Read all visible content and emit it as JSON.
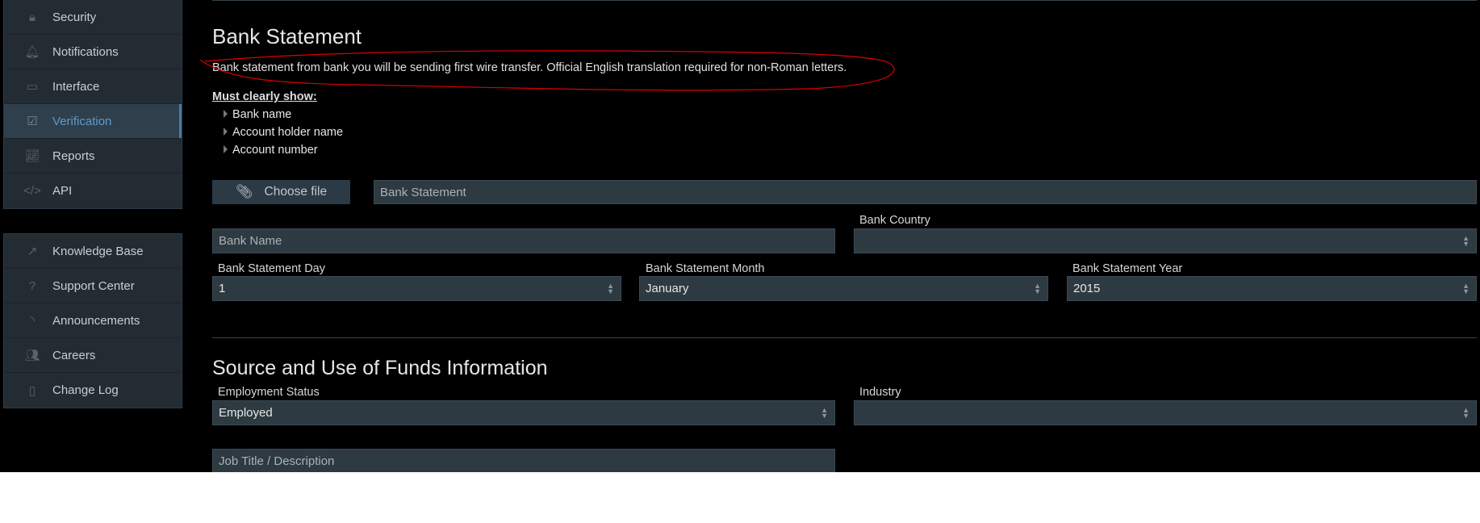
{
  "sidebar": {
    "group1": [
      {
        "label": "Security",
        "icon": "lock-icon"
      },
      {
        "label": "Notifications",
        "icon": "bell-icon"
      },
      {
        "label": "Interface",
        "icon": "monitor-icon"
      },
      {
        "label": "Verification",
        "icon": "checkbox-icon",
        "active": true
      },
      {
        "label": "Reports",
        "icon": "chart-icon"
      },
      {
        "label": "API",
        "icon": "code-icon"
      }
    ],
    "group2": [
      {
        "label": "Knowledge Base",
        "icon": "external-link-icon"
      },
      {
        "label": "Support Center",
        "icon": "question-icon"
      },
      {
        "label": "Announcements",
        "icon": "rss-icon"
      },
      {
        "label": "Careers",
        "icon": "users-icon"
      },
      {
        "label": "Change Log",
        "icon": "map-icon"
      }
    ]
  },
  "bank": {
    "title": "Bank Statement",
    "description": "Bank statement from bank you will be sending first wire transfer. Official English translation required for non-Roman letters.",
    "must_show": "Must clearly show:",
    "requirements": [
      "Bank name",
      "Account holder name",
      "Account number"
    ],
    "choose_file": "Choose file",
    "file_placeholder": "Bank Statement",
    "bank_name_placeholder": "Bank Name",
    "bank_country_label": "Bank Country",
    "bank_country_value": "",
    "day_label": "Bank Statement Day",
    "day_value": "1",
    "month_label": "Bank Statement Month",
    "month_value": "January",
    "year_label": "Bank Statement Year",
    "year_value": "2015"
  },
  "funds": {
    "title": "Source and Use of Funds Information",
    "employment_label": "Employment Status",
    "employment_value": "Employed",
    "industry_label": "Industry",
    "industry_value": "",
    "job_placeholder": "Job Title / Description"
  },
  "annotation_color": "#e00000"
}
